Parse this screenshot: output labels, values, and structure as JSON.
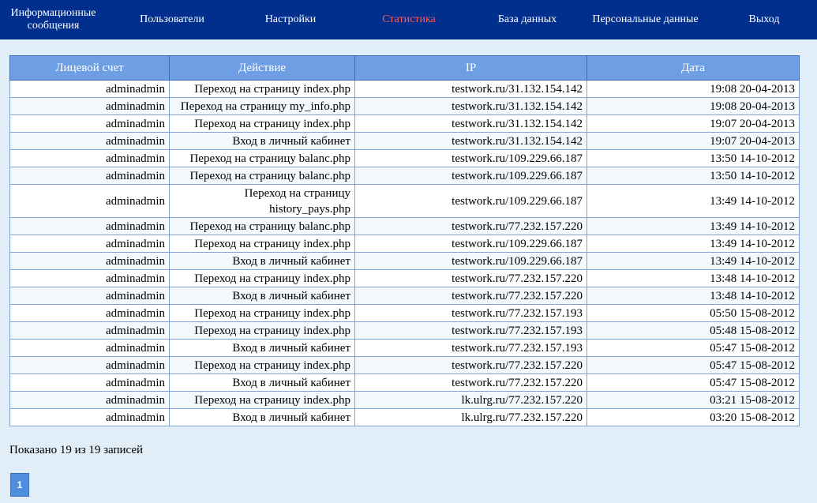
{
  "nav": {
    "items": [
      {
        "label": "Информационные\nсообщения",
        "active": false
      },
      {
        "label": "Пользователи",
        "active": false
      },
      {
        "label": "Настройки",
        "active": false
      },
      {
        "label": "Статистика",
        "active": true
      },
      {
        "label": "База данных",
        "active": false
      },
      {
        "label": "Персональные данные",
        "active": false
      },
      {
        "label": "Выход",
        "active": false
      }
    ],
    "active_color": "#ff5a5a",
    "background": "#012f8d"
  },
  "table": {
    "columns": [
      "Лицевой счет",
      "Действие",
      "IP",
      "Дата"
    ],
    "rows": [
      [
        "adminadmin",
        "Переход на страницу index.php",
        "testwork.ru/31.132.154.142",
        "19:08 20-04-2013"
      ],
      [
        "adminadmin",
        "Переход на страницу my_info.php",
        "testwork.ru/31.132.154.142",
        "19:08 20-04-2013"
      ],
      [
        "adminadmin",
        "Переход на страницу index.php",
        "testwork.ru/31.132.154.142",
        "19:07 20-04-2013"
      ],
      [
        "adminadmin",
        "Вход в личный кабинет",
        "testwork.ru/31.132.154.142",
        "19:07 20-04-2013"
      ],
      [
        "adminadmin",
        "Переход на страницу balanc.php",
        "testwork.ru/109.229.66.187",
        "13:50 14-10-2012"
      ],
      [
        "adminadmin",
        "Переход на страницу balanc.php",
        "testwork.ru/109.229.66.187",
        "13:50 14-10-2012"
      ],
      [
        "adminadmin",
        "Переход на страницу history_pays.php",
        "testwork.ru/109.229.66.187",
        "13:49 14-10-2012"
      ],
      [
        "adminadmin",
        "Переход на страницу balanc.php",
        "testwork.ru/77.232.157.220",
        "13:49 14-10-2012"
      ],
      [
        "adminadmin",
        "Переход на страницу index.php",
        "testwork.ru/109.229.66.187",
        "13:49 14-10-2012"
      ],
      [
        "adminadmin",
        "Вход в личный кабинет",
        "testwork.ru/109.229.66.187",
        "13:49 14-10-2012"
      ],
      [
        "adminadmin",
        "Переход на страницу index.php",
        "testwork.ru/77.232.157.220",
        "13:48 14-10-2012"
      ],
      [
        "adminadmin",
        "Вход в личный кабинет",
        "testwork.ru/77.232.157.220",
        "13:48 14-10-2012"
      ],
      [
        "adminadmin",
        "Переход на страницу index.php",
        "testwork.ru/77.232.157.193",
        "05:50 15-08-2012"
      ],
      [
        "adminadmin",
        "Переход на страницу index.php",
        "testwork.ru/77.232.157.193",
        "05:48 15-08-2012"
      ],
      [
        "adminadmin",
        "Вход в личный кабинет",
        "testwork.ru/77.232.157.193",
        "05:47 15-08-2012"
      ],
      [
        "adminadmin",
        "Переход на страницу index.php",
        "testwork.ru/77.232.157.220",
        "05:47 15-08-2012"
      ],
      [
        "adminadmin",
        "Вход в личный кабинет",
        "testwork.ru/77.232.157.220",
        "05:47 15-08-2012"
      ],
      [
        "adminadmin",
        "Переход на страницу index.php",
        "lk.ulrg.ru/77.232.157.220",
        "03:21 15-08-2012"
      ],
      [
        "adminadmin",
        "Вход в личный кабинет",
        "lk.ulrg.ru/77.232.157.220",
        "03:20 15-08-2012"
      ]
    ]
  },
  "footer": {
    "info": "Показано 19 из 19 записей",
    "page": "1"
  }
}
